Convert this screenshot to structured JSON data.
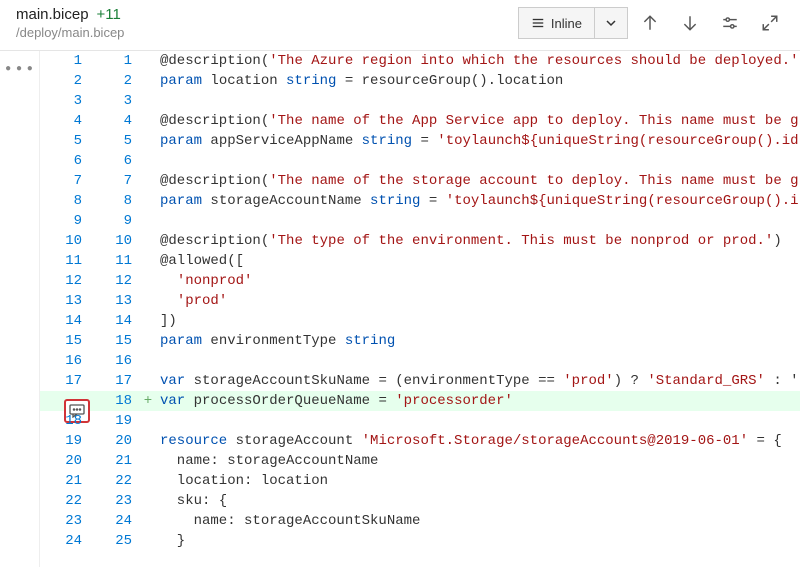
{
  "header": {
    "filename": "main.bicep",
    "diffcount": "+11",
    "filepath": "/deploy/main.bicep",
    "inline_label": "Inline"
  },
  "icons": {
    "more": "⋮",
    "lines": "lines-icon",
    "chevron": "chevron-down-icon",
    "up": "arrow-up-icon",
    "down": "arrow-down-icon",
    "settings": "sliders-icon",
    "expand": "expand-icon",
    "comment": "comment-icon"
  },
  "code_rows": [
    {
      "old": "1",
      "new": "1",
      "sign": "",
      "added": false,
      "tokens": [
        {
          "t": "dec",
          "v": "@description"
        },
        {
          "t": "op",
          "v": "("
        },
        {
          "t": "str",
          "v": "'The Azure region into which the resources should be deployed.'"
        }
      ]
    },
    {
      "old": "2",
      "new": "2",
      "sign": "",
      "added": false,
      "tokens": [
        {
          "t": "kw",
          "v": "param"
        },
        {
          "t": "op",
          "v": " location "
        },
        {
          "t": "kw",
          "v": "string"
        },
        {
          "t": "op",
          "v": " = resourceGroup().location"
        }
      ]
    },
    {
      "old": "3",
      "new": "3",
      "sign": "",
      "added": false,
      "tokens": []
    },
    {
      "old": "4",
      "new": "4",
      "sign": "",
      "added": false,
      "tokens": [
        {
          "t": "dec",
          "v": "@description"
        },
        {
          "t": "op",
          "v": "("
        },
        {
          "t": "str",
          "v": "'The name of the App Service app to deploy. This name must be g"
        }
      ]
    },
    {
      "old": "5",
      "new": "5",
      "sign": "",
      "added": false,
      "tokens": [
        {
          "t": "kw",
          "v": "param"
        },
        {
          "t": "op",
          "v": " appServiceAppName "
        },
        {
          "t": "kw",
          "v": "string"
        },
        {
          "t": "op",
          "v": " = "
        },
        {
          "t": "str",
          "v": "'toylaunch${uniqueString(resourceGroup().id"
        }
      ]
    },
    {
      "old": "6",
      "new": "6",
      "sign": "",
      "added": false,
      "tokens": []
    },
    {
      "old": "7",
      "new": "7",
      "sign": "",
      "added": false,
      "tokens": [
        {
          "t": "dec",
          "v": "@description"
        },
        {
          "t": "op",
          "v": "("
        },
        {
          "t": "str",
          "v": "'The name of the storage account to deploy. This name must be g"
        }
      ]
    },
    {
      "old": "8",
      "new": "8",
      "sign": "",
      "added": false,
      "tokens": [
        {
          "t": "kw",
          "v": "param"
        },
        {
          "t": "op",
          "v": " storageAccountName "
        },
        {
          "t": "kw",
          "v": "string"
        },
        {
          "t": "op",
          "v": " = "
        },
        {
          "t": "str",
          "v": "'toylaunch${uniqueString(resourceGroup().i"
        }
      ]
    },
    {
      "old": "9",
      "new": "9",
      "sign": "",
      "added": false,
      "tokens": []
    },
    {
      "old": "10",
      "new": "10",
      "sign": "",
      "added": false,
      "tokens": [
        {
          "t": "dec",
          "v": "@description"
        },
        {
          "t": "op",
          "v": "("
        },
        {
          "t": "str",
          "v": "'The type of the environment. This must be nonprod or prod.'"
        },
        {
          "t": "op",
          "v": ")"
        }
      ]
    },
    {
      "old": "11",
      "new": "11",
      "sign": "",
      "added": false,
      "tokens": [
        {
          "t": "dec",
          "v": "@allowed"
        },
        {
          "t": "op",
          "v": "(["
        }
      ]
    },
    {
      "old": "12",
      "new": "12",
      "sign": "",
      "added": false,
      "tokens": [
        {
          "t": "op",
          "v": "  "
        },
        {
          "t": "str",
          "v": "'nonprod'"
        }
      ]
    },
    {
      "old": "13",
      "new": "13",
      "sign": "",
      "added": false,
      "tokens": [
        {
          "t": "op",
          "v": "  "
        },
        {
          "t": "str",
          "v": "'prod'"
        }
      ]
    },
    {
      "old": "14",
      "new": "14",
      "sign": "",
      "added": false,
      "tokens": [
        {
          "t": "op",
          "v": "])"
        }
      ]
    },
    {
      "old": "15",
      "new": "15",
      "sign": "",
      "added": false,
      "tokens": [
        {
          "t": "kw",
          "v": "param"
        },
        {
          "t": "op",
          "v": " environmentType "
        },
        {
          "t": "kw",
          "v": "string"
        }
      ]
    },
    {
      "old": "16",
      "new": "16",
      "sign": "",
      "added": false,
      "tokens": []
    },
    {
      "old": "17",
      "new": "17",
      "sign": "",
      "added": false,
      "tokens": [
        {
          "t": "kw",
          "v": "var"
        },
        {
          "t": "op",
          "v": " storageAccountSkuName = (environmentType == "
        },
        {
          "t": "str",
          "v": "'prod'"
        },
        {
          "t": "op",
          "v": ") ? "
        },
        {
          "t": "str",
          "v": "'Standard_GRS'"
        },
        {
          "t": "op",
          "v": " : '"
        }
      ]
    },
    {
      "old": "",
      "new": "18",
      "sign": "+",
      "added": true,
      "comment": true,
      "tokens": [
        {
          "t": "kw",
          "v": "var"
        },
        {
          "t": "op",
          "v": " processOrderQueueName = "
        },
        {
          "t": "str",
          "v": "'processorder'"
        }
      ]
    },
    {
      "old": "18",
      "new": "19",
      "sign": "",
      "added": false,
      "tokens": []
    },
    {
      "old": "19",
      "new": "20",
      "sign": "",
      "added": false,
      "tokens": [
        {
          "t": "kw",
          "v": "resource"
        },
        {
          "t": "op",
          "v": " storageAccount "
        },
        {
          "t": "str",
          "v": "'Microsoft.Storage/storageAccounts@2019-06-01'"
        },
        {
          "t": "op",
          "v": " = {"
        }
      ]
    },
    {
      "old": "20",
      "new": "21",
      "sign": "",
      "added": false,
      "tokens": [
        {
          "t": "op",
          "v": "  name: storageAccountName"
        }
      ]
    },
    {
      "old": "21",
      "new": "22",
      "sign": "",
      "added": false,
      "tokens": [
        {
          "t": "op",
          "v": "  location: location"
        }
      ]
    },
    {
      "old": "22",
      "new": "23",
      "sign": "",
      "added": false,
      "tokens": [
        {
          "t": "op",
          "v": "  sku: {"
        }
      ]
    },
    {
      "old": "23",
      "new": "24",
      "sign": "",
      "added": false,
      "tokens": [
        {
          "t": "op",
          "v": "    name: storageAccountSkuName"
        }
      ]
    },
    {
      "old": "24",
      "new": "25",
      "sign": "",
      "added": false,
      "tokens": [
        {
          "t": "op",
          "v": "  }"
        }
      ]
    }
  ]
}
